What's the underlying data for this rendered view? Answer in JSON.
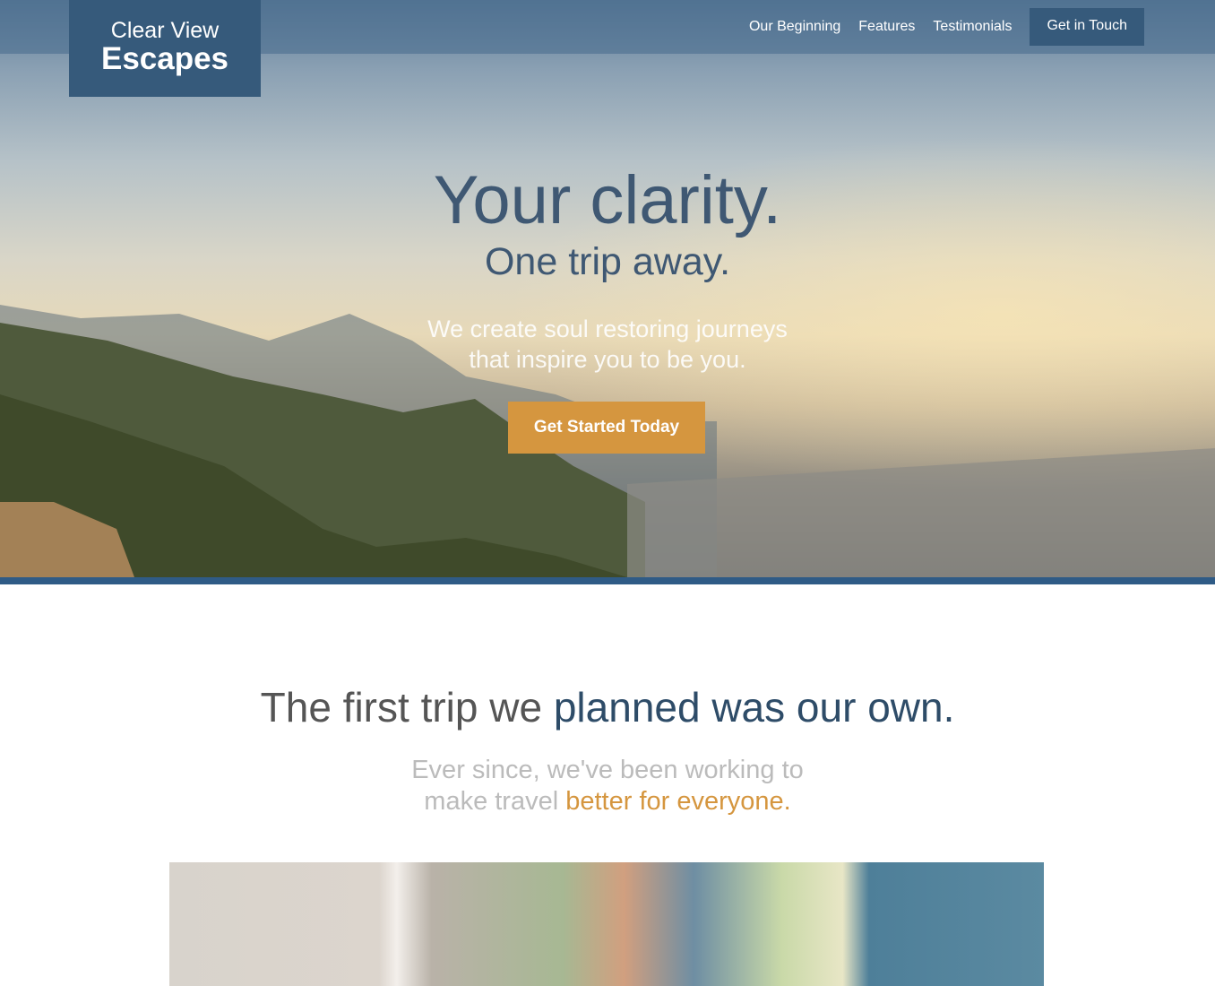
{
  "brand": {
    "line1": "Clear View",
    "line2": "Escapes"
  },
  "nav": {
    "items": [
      "Our Beginning",
      "Features",
      "Testimonials"
    ],
    "cta": "Get in Touch"
  },
  "hero": {
    "title": "Your clarity.",
    "subtitle": "One trip away.",
    "tagline_1": "We create soul restoring journeys",
    "tagline_2": "that inspire you to be you.",
    "button": "Get Started Today"
  },
  "story": {
    "heading_light": "The first trip we ",
    "heading_bold": "planned was our own.",
    "text_1": "Ever since, we've been working to",
    "text_2_light": "make travel ",
    "text_2_accent": "better for everyone."
  },
  "colors": {
    "primary": "#365a7b",
    "accent": "#d5963f"
  }
}
